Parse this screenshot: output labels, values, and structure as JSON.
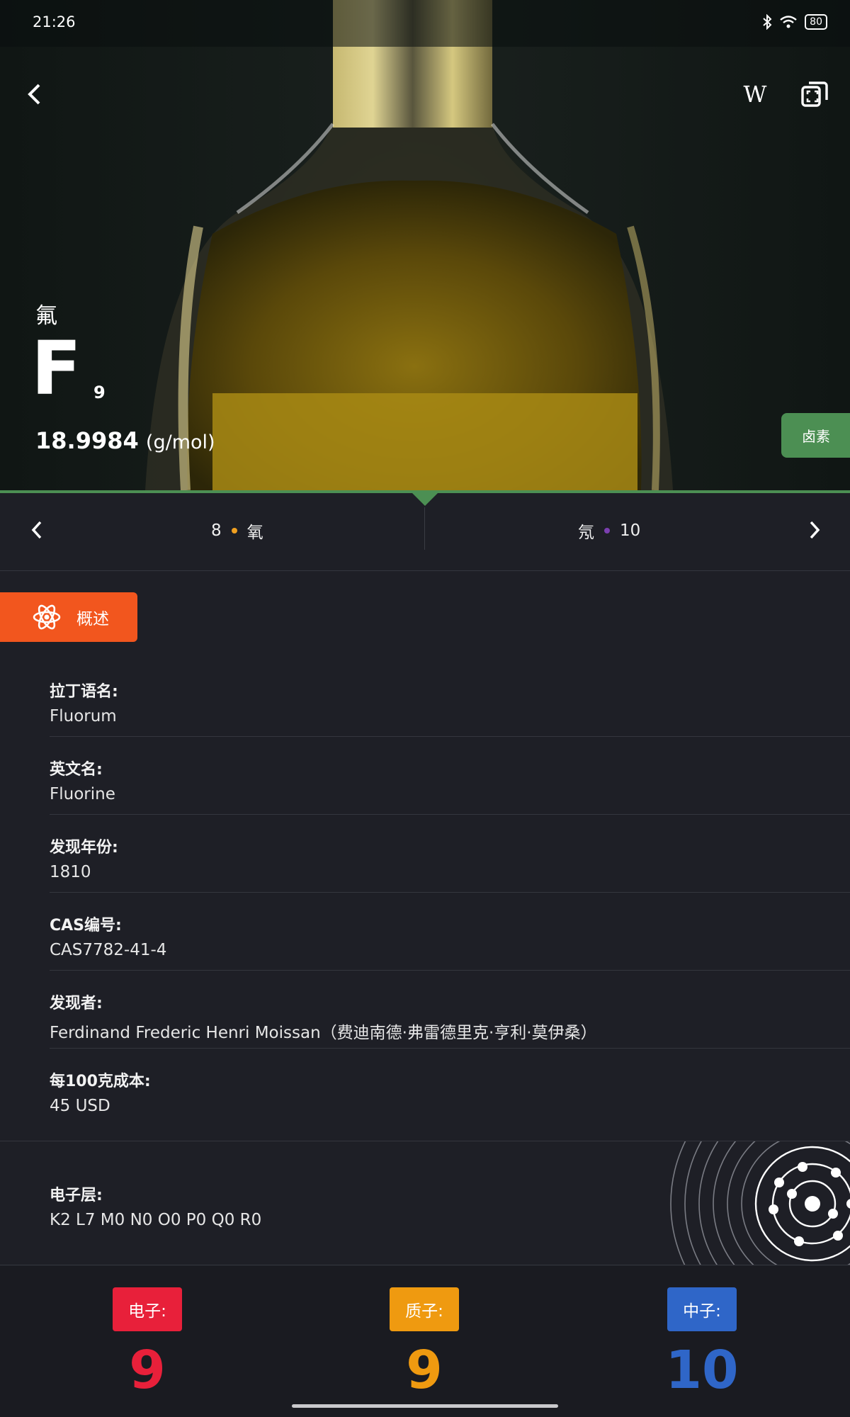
{
  "status_bar": {
    "time": "21:26",
    "battery": "80"
  },
  "header": {
    "wiki_label": "W"
  },
  "element": {
    "name_cn": "氟",
    "symbol": "F",
    "atomic_number": "9",
    "mass": "18.9984",
    "mass_unit": "(g/mol)",
    "category": "卤素",
    "category_color": "#4c8f53"
  },
  "nav": {
    "prev_number": "8",
    "prev_name": "氧",
    "prev_color": "#f0a020",
    "next_name": "氖",
    "next_number": "10",
    "next_color": "#7b3fb0"
  },
  "tab": {
    "label": "概述",
    "color": "#f2561e"
  },
  "info": [
    {
      "label": "拉丁语名:",
      "value": "Fluorum"
    },
    {
      "label": "英文名:",
      "value": "Fluorine"
    },
    {
      "label": "发现年份:",
      "value": "1810"
    },
    {
      "label": "CAS编号:",
      "value": "CAS7782-41-4"
    },
    {
      "label": "发现者:",
      "value": "Ferdinand Frederic Henri Moissan（费迪南德·弗雷德里克·亨利·莫伊桑）"
    },
    {
      "label": "每100克成本:",
      "value": "45 USD"
    }
  ],
  "shells": {
    "label": "电子层:",
    "value": "K2 L7 M0 N0 O0 P0 Q0 R0"
  },
  "particles": {
    "electrons": {
      "label": "电子:",
      "count": "9",
      "color": "#e8203a"
    },
    "protons": {
      "label": "质子:",
      "count": "9",
      "color": "#ef9a10"
    },
    "neutrons": {
      "label": "中子:",
      "count": "10",
      "color": "#2f66c8"
    }
  }
}
